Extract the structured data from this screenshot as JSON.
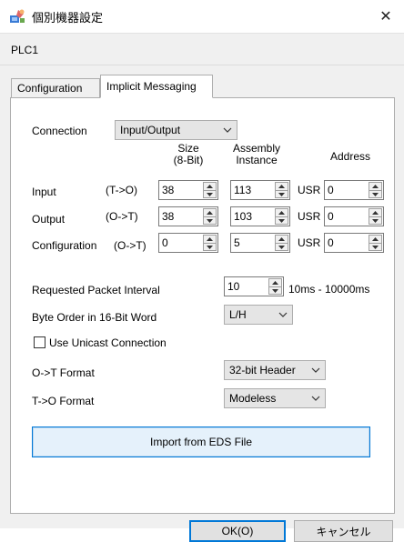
{
  "window": {
    "title": "個別機器設定",
    "close_glyph": "✕",
    "icon": "device-settings-icon"
  },
  "device_label": "PLC1",
  "tabs": [
    {
      "label": "Configuration",
      "active": false
    },
    {
      "label": "Implicit Messaging",
      "active": true
    }
  ],
  "connection": {
    "label": "Connection",
    "value": "Input/Output"
  },
  "headers": {
    "size_line1": "Size",
    "size_line2": "(8-Bit)",
    "assembly_line1": "Assembly",
    "assembly_line2": "Instance",
    "address": "Address"
  },
  "rows": [
    {
      "label": "Input",
      "direction": "(T->O)",
      "size": "38",
      "instance": "113",
      "address_prefix": "USR",
      "address": "0"
    },
    {
      "label": "Output",
      "direction": "(O->T)",
      "size": "38",
      "instance": "103",
      "address_prefix": "USR",
      "address": "0"
    },
    {
      "label": "Configuration",
      "direction": "(O->T)",
      "size": "0",
      "instance": "5",
      "address_prefix": "USR",
      "address": "0"
    }
  ],
  "rpi": {
    "label": "Requested Packet Interval",
    "value": "10",
    "range": "10ms - 10000ms"
  },
  "byte_order": {
    "label": "Byte Order in 16-Bit Word",
    "value": "L/H"
  },
  "unicast": {
    "label": "Use Unicast Connection",
    "checked": false
  },
  "ot_format": {
    "label": "O->T Format",
    "value": "32-bit Header"
  },
  "to_format": {
    "label": "T->O Format",
    "value": "Modeless"
  },
  "import_button": "Import from EDS File",
  "ok_button": "OK(O)",
  "cancel_button": "キャンセル",
  "colors": {
    "accent": "#0078d7",
    "dialog_bg": "#f0f0f0",
    "panel_bg": "#ffffff"
  }
}
